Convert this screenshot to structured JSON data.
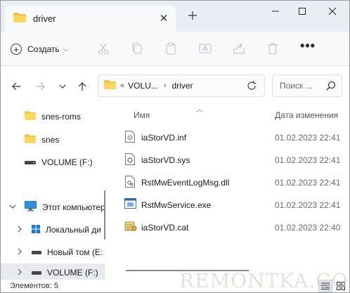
{
  "tab": {
    "title": "driver",
    "folder_icon": "folder-icon",
    "close_icon": "close-icon"
  },
  "window": {
    "new_tab_icon": "plus-icon",
    "minimize_icon": "minimize-icon",
    "maximize_icon": "maximize-icon",
    "close_icon": "close-icon"
  },
  "toolbar": {
    "create_label": "Создать",
    "icons": [
      "cut-icon",
      "copy-icon",
      "paste-icon",
      "rename-icon",
      "share-icon",
      "delete-icon"
    ],
    "more_label": "•••"
  },
  "navigation": {
    "back_icon": "arrow-left-icon",
    "forward_icon": "arrow-right-icon",
    "recent_icon": "chevron-down-icon",
    "up_icon": "arrow-up-icon",
    "breadcrumb": {
      "overflow": "«",
      "drive": "VOLU...",
      "folder": "driver",
      "separator": "›"
    },
    "refresh_icon": "refresh-icon",
    "search_placeholder": "Поиск ...",
    "search_icon": "search-icon"
  },
  "sidebar": {
    "items": [
      {
        "label": "snes-roms",
        "icon": "folder-icon"
      },
      {
        "label": "snes",
        "icon": "folder-icon"
      },
      {
        "label": "VOLUME (F:)",
        "icon": "drive-icon"
      },
      {
        "label": "Этот компьютер",
        "icon": "computer-icon"
      },
      {
        "label": "Локальный ди",
        "icon": "windows-drive-icon"
      },
      {
        "label": "Новый том (E:",
        "icon": "drive-icon"
      },
      {
        "label": "VOLUME (F:)",
        "icon": "drive-icon"
      }
    ]
  },
  "columns": {
    "name": "Имя",
    "date": "Дата изменения"
  },
  "files": [
    {
      "name": "iaStorVD.inf",
      "date": "01.02.2023 22:41",
      "icon": "inf-file-icon"
    },
    {
      "name": "iaStorVD.sys",
      "date": "01.02.2023 22:41",
      "icon": "sys-file-icon"
    },
    {
      "name": "RstMwEventLogMsg.dll",
      "date": "01.02.2023 22:41",
      "icon": "dll-file-icon"
    },
    {
      "name": "RstMwService.exe",
      "date": "01.02.2023 22:41",
      "icon": "exe-file-icon"
    },
    {
      "name": "iaStorVD.cat",
      "date": "01.02.2023 22:40",
      "icon": "cat-file-icon"
    }
  ],
  "status": {
    "items_text": "Элементов: 5"
  },
  "watermark": "REMONTKA.COM"
}
